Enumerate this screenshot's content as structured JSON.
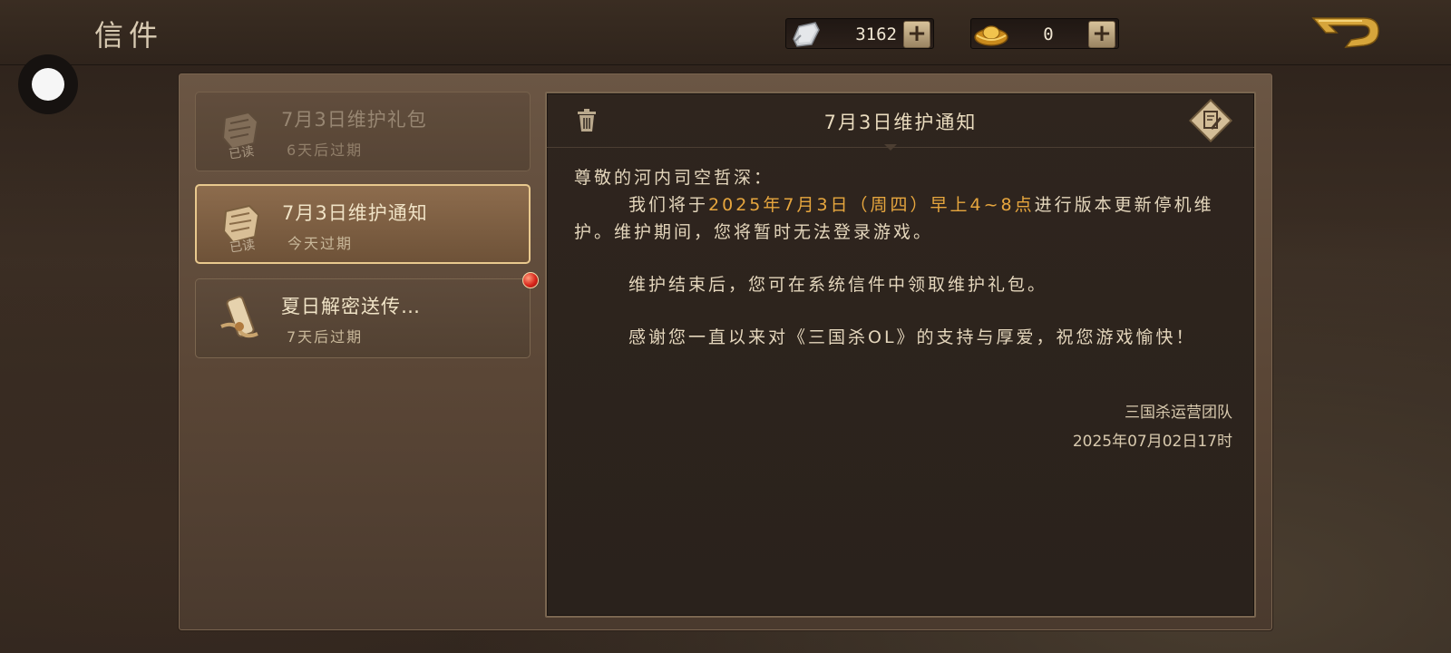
{
  "header": {
    "title": "信件",
    "silver_value": "3162",
    "gold_value": "0",
    "plus_label": "+"
  },
  "mails": [
    {
      "title": "7月3日维护礼包",
      "expire": "6天后过期",
      "stamp": "已读",
      "state": "read"
    },
    {
      "title": "7月3日维护通知",
      "expire": "今天过期",
      "stamp": "已读",
      "state": "selected"
    },
    {
      "title": "夏日解密送传…",
      "expire": "7天后过期",
      "stamp": "",
      "state": "unread"
    }
  ],
  "letter": {
    "title": "7月3日维护通知",
    "greeting": "尊敬的河内司空哲深：",
    "p1_before": "我们将于",
    "p1_highlight": "2025年7月3日（周四）早上4~8点",
    "p1_after": "进行版本更新停机维护。维护期间，您将暂时无法登录游戏。",
    "p2": "维护结束后，您可在系统信件中领取维护礼包。",
    "p3": "感谢您一直以来对《三国杀OL》的支持与厚爱，祝您游戏愉快！",
    "signature": "三国杀运营团队",
    "date": "2025年07月02日17时"
  },
  "colors": {
    "highlight": "#e7a63e",
    "selected_border": "#e9c98e",
    "unread_dot": "#d8261c"
  },
  "icons": [
    "silver-ingot-icon",
    "gold-ingot-icon",
    "back-arrow-icon",
    "trash-icon",
    "edit-icon",
    "scroll-icon"
  ]
}
